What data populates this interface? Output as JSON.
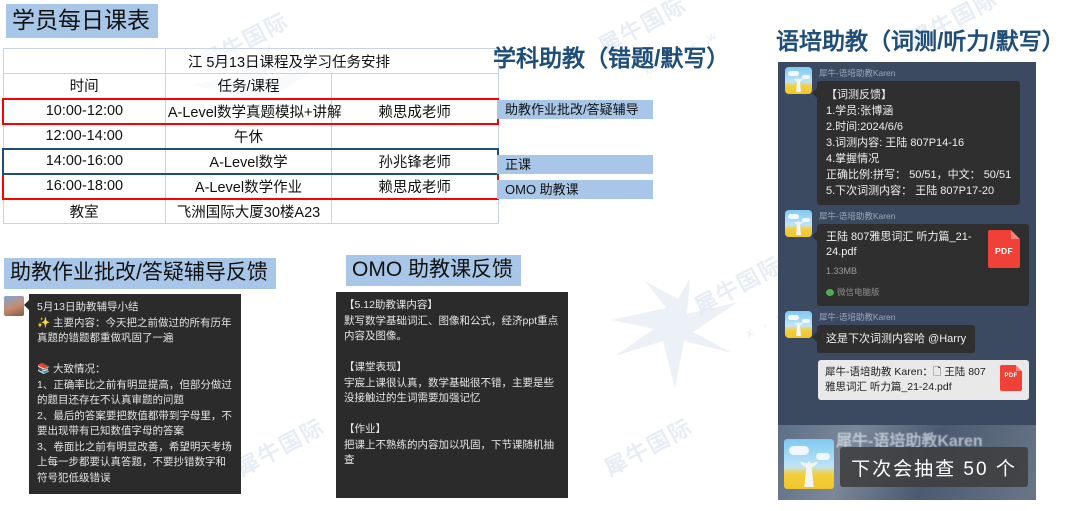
{
  "schedule": {
    "title": "学员每日课表",
    "caption": "江        5月13日课程及学习任务安排",
    "headers": {
      "time": "时间",
      "task": "任务/课程",
      "teacher": ""
    },
    "rows": [
      {
        "time": "10:00-12:00",
        "task": "A-Level数学真题模拟+讲解",
        "teacher": "赖思成老师",
        "hl": "red"
      },
      {
        "time": "12:00-14:00",
        "task": "午休",
        "teacher": "",
        "hl": ""
      },
      {
        "time": "14:00-16:00",
        "task": "A-Level数学",
        "teacher": "孙兆锋老师",
        "hl": "blue"
      },
      {
        "time": "16:00-18:00",
        "task": "A-Level数学作业",
        "teacher": "赖思成老师",
        "hl": "red"
      },
      {
        "time": "教室",
        "task": "飞洲国际大厦30楼A23",
        "teacher": "",
        "hl": ""
      }
    ]
  },
  "mid": {
    "title": "学科助教（错题/默写）",
    "tags": [
      {
        "label": "助教作业批改/答疑辅导"
      },
      {
        "label": "正课"
      },
      {
        "label": "OMO 助教课"
      }
    ]
  },
  "feedback_left": {
    "title": "助教作业批改/答疑辅导反馈",
    "lines": "5月13日助教辅导小结\n✨ 主要内容：今天把之前做过的所有历年真题的错题都重做巩固了一遍\n\n📚 大致情况：\n1、正确率比之前有明显提高，但部分做过的题目还存在不认真审题的问题\n2、最后的答案要把数值都带到字母里，不要出现带有已知数值字母的答案\n3、卷面比之前有明显改善，希望明天考场上每一步都要认真答题，不要抄错数字和符号犯低级错误"
  },
  "feedback_omo": {
    "title": "OMO 助教课反馈",
    "lines": "【5.12助教课内容】\n默写数学基础词汇、图像和公式，经济ppt重点内容及图像。\n\n【课堂表现】\n宇宸上课很认真，数学基础很不错，主要是些没接触过的生词需要加强记忆\n\n【作业】\n把课上不熟练的内容加以巩固，下节课随机抽查"
  },
  "chat": {
    "title": "语培助教（词测/听力/默写）",
    "sender": "犀牛-语培助教Karen",
    "messages": [
      {
        "type": "text",
        "sender": "犀牛-语培助教Karen",
        "text": "【词测反馈】\n1.学员:张博涵\n2.时间:2024/6/6\n3.词测内容: 王陆 807P14-16\n4.掌握情况\n正确比例:拼写： 50/51，中文： 50/51\n5.下次词测内容： 王陆 807P17-20"
      },
      {
        "type": "file",
        "sender": "犀牛-语培助教Karen",
        "filename": "王陆 807雅思词汇 听力篇_21-24.pdf",
        "filesize": "1.33MB",
        "source": "微信电脑版",
        "icon": "pdf-icon"
      },
      {
        "type": "text",
        "sender": "犀牛-语培助教Karen",
        "text": "这是下次词测内容哈 @Harry"
      }
    ],
    "quote": {
      "text": "犀牛-语培助教 Karen：🗋 王陆 807雅思词汇 听力篇_21-24.pdf",
      "icon": "pdf-icon"
    },
    "overlay": {
      "sender": "犀牛-语培助教Karen",
      "text": "下次会抽查 50 个"
    }
  },
  "watermark": {
    "text": "犀牛国际",
    "sub": "X - N E W"
  },
  "colors": {
    "chip_bg": "#a8c7e8",
    "title_blue": "#1f4e79",
    "highlight_red": "#ff0000",
    "highlight_blue": "#1f4e79",
    "chat_bg": "#3c4a61",
    "bubble_bg": "#2f2f2f",
    "pdf_red": "#ef4136"
  }
}
